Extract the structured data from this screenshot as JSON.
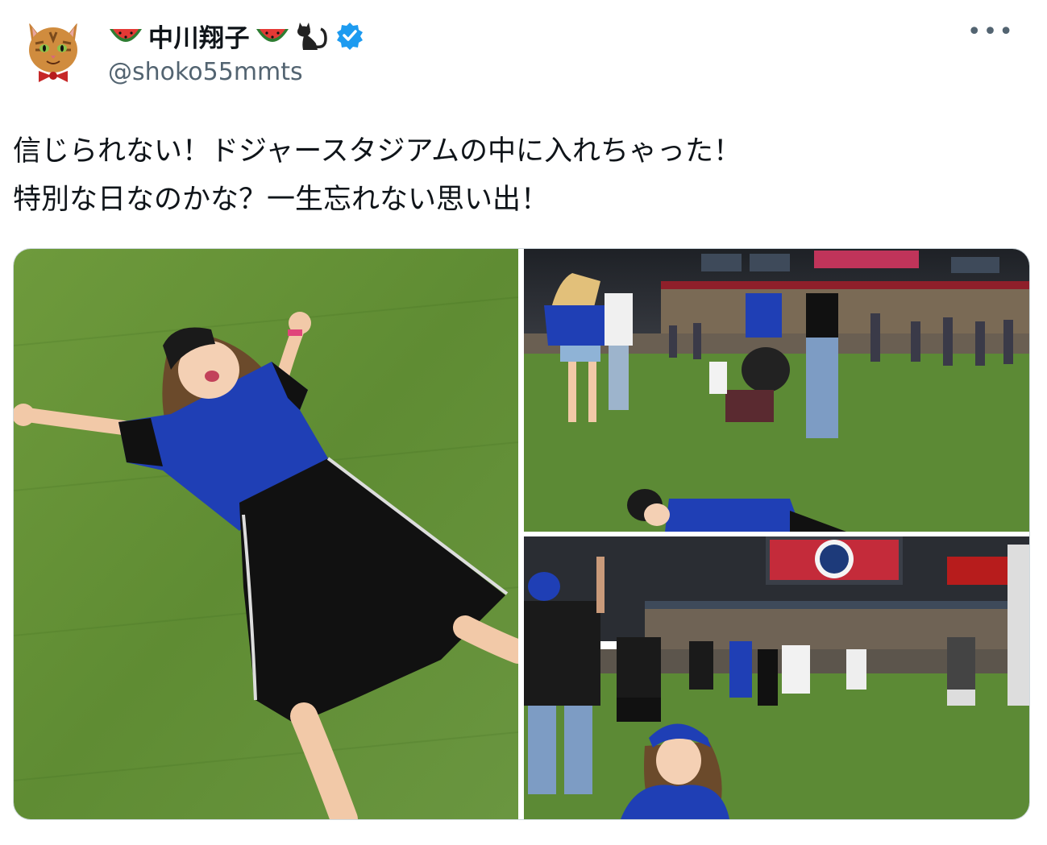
{
  "author": {
    "display_name": "中川翔子",
    "handle": "@shoko55mmts",
    "avatar_icon": "cat-with-bowtie-avatar",
    "name_emojis": [
      "watermelon-icon",
      "watermelon-icon",
      "black-cat-icon"
    ],
    "verified_icon": "verified-badge-icon",
    "verified_color": "#1d9bf0"
  },
  "menu": {
    "more_label": "•••"
  },
  "tweet": {
    "text_line1": "信じられない！ドジャースタジアムの中に入れちゃった！",
    "text_line2": "特別な日なのかな？一生忘れない思い出！"
  },
  "media": {
    "photos": [
      {
        "name": "woman lying on grass"
      },
      {
        "name": "crowd on field"
      },
      {
        "name": "selfie with crowd"
      }
    ],
    "colors": {
      "grass": "#5f8a34",
      "jersey": "#1f3fb5",
      "sky": "#2a2d33"
    }
  }
}
